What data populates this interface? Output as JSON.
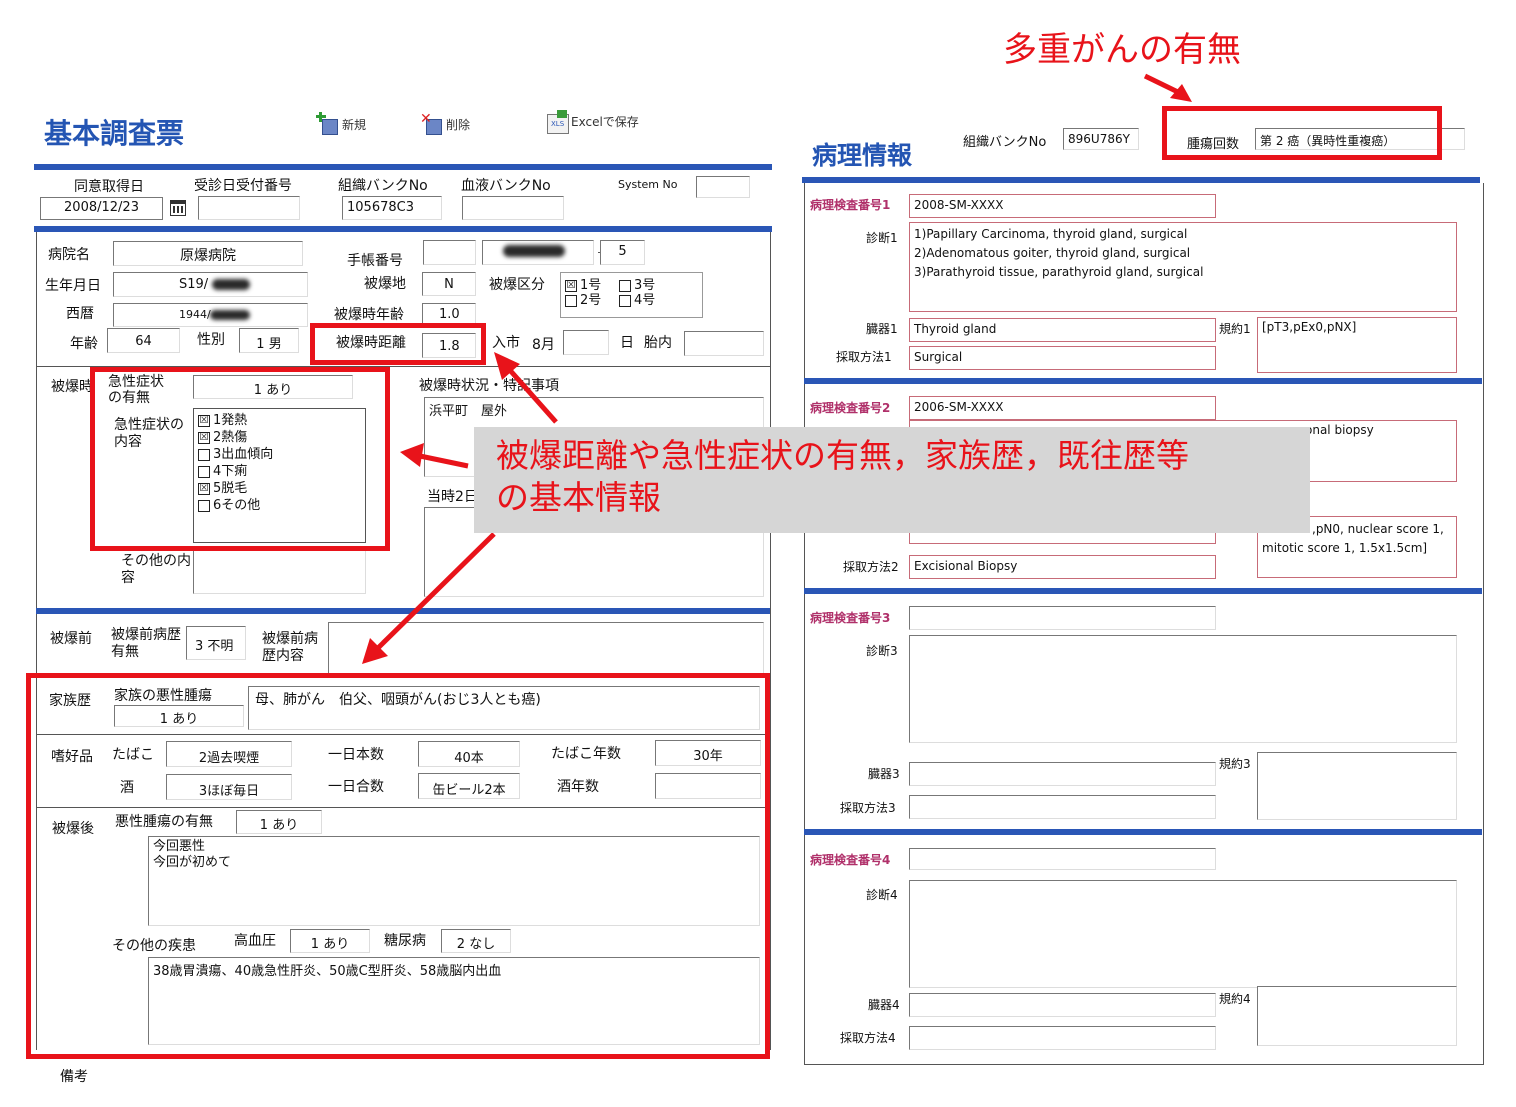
{
  "annotation_top": "多重がんの有無",
  "callout": {
    "line1": "被爆距離や急性症状の有無，家族歴，既往歴等",
    "line2": "の基本情報"
  },
  "left": {
    "title": "基本調査票",
    "toolbar": {
      "new": "新規",
      "delete": "削除",
      "excel": "Excelで保存"
    },
    "row1": {
      "consent_date_label": "同意取得日",
      "consent_date": "2008/12/23",
      "reception_label": "受診日受付番号",
      "tissue_bank_label": "組織バンクNo",
      "tissue_bank": "105678C3",
      "blood_bank_label": "血液バンクNo",
      "system_no_label": "System No"
    },
    "basic": {
      "hospital_label": "病院名",
      "hospital": "原爆病院",
      "notebook_label": "手帳番号",
      "notebook_suffix": "5",
      "birth_label": "生年月日",
      "birth": "S19/",
      "exposure_place_label": "被爆地",
      "exposure_place": "N",
      "exposure_class_label": "被爆区分",
      "class_options": [
        {
          "label": "1号",
          "checked": "☒"
        },
        {
          "label": "3号",
          "checked": ""
        },
        {
          "label": "2号",
          "checked": ""
        },
        {
          "label": "4号",
          "checked": ""
        }
      ],
      "western_label": "西暦",
      "western": "1944/",
      "age_at_exposure_label": "被爆時年齢",
      "age_at_exposure": "1.0",
      "age_label": "年齢",
      "age": "64",
      "sex_label": "性別",
      "sex": "1 男",
      "distance_label": "被爆時距離",
      "distance": "1.8",
      "entry_label": "入市",
      "entry_month": "8月",
      "day_label": "日",
      "in_utero_label": "胎内"
    },
    "acute": {
      "section_label": "被爆時",
      "presence_label": "急性症状の有無",
      "presence": "1 あり",
      "content_label": "急性症状の内容",
      "symptoms": [
        {
          "label": "1発熱",
          "checked": "☒"
        },
        {
          "label": "2熱傷",
          "checked": "☒"
        },
        {
          "label": "3出血傾向",
          "checked": ""
        },
        {
          "label": "4下痢",
          "checked": ""
        },
        {
          "label": "5脱毛",
          "checked": "☒"
        },
        {
          "label": "6その他",
          "checked": ""
        }
      ],
      "other_label": "その他の内容",
      "situation_label": "被爆時状況・特記事項",
      "situation": "浜平町　屋外",
      "situation2_label": "当時2日"
    },
    "pre": {
      "section_label": "被爆前",
      "history_label": "被爆前病歴有無",
      "history": "3 不明",
      "content_label": "被爆前病歴内容"
    },
    "family": {
      "section_label": "家族歴",
      "malignancy_label": "家族の悪性腫瘍",
      "malignancy": "1 あり",
      "detail": "母、肺がん　伯父、咽頭がん(おじ3人とも癌)"
    },
    "habits": {
      "section_label": "嗜好品",
      "tobacco_label": "たばこ",
      "tobacco": "2過去喫煙",
      "daily_count_label": "一日本数",
      "daily_count": "40本",
      "tobacco_years_label": "たばこ年数",
      "tobacco_years": "30年",
      "alcohol_label": "酒",
      "alcohol": "3ほぼ毎日",
      "daily_amount_label": "一日合数",
      "daily_amount": "缶ビール2本",
      "alcohol_years_label": "酒年数"
    },
    "post": {
      "section_label": "被爆後",
      "malignancy_label": "悪性腫瘍の有無",
      "malignancy": "1 あり",
      "note_line1": "今回悪性",
      "note_line2": "今回が初めて",
      "other_disease_label": "その他の疾患",
      "hypertension_label": "高血圧",
      "hypertension": "1 あり",
      "diabetes_label": "糖尿病",
      "diabetes": "2 なし",
      "other_detail": "38歳胃潰瘍、40歳急性肝炎、50歳C型肝炎、58歳脳内出血"
    },
    "remarks_label": "備考"
  },
  "right": {
    "title": "病理情報",
    "tissue_bank_label": "組織バンクNo",
    "tissue_bank": "896U786Y",
    "tumor_count_label": "腫瘍回数",
    "tumor_count": "第 2 癌（異時性重複癌）",
    "path1": {
      "no_label": "病理検査番号1",
      "no": "2008-SM-XXXX",
      "dx_label": "診断1",
      "dx_lines": [
        "1)Papillary Carcinoma, thyroid gland, surgical",
        "2)Adenomatous goiter, thyroid gland, surgical",
        "3)Parathyroid tissue, parathyroid gland, surgical"
      ],
      "organ_label": "臓器1",
      "organ": "Thyroid gland",
      "rule_label": "規約1",
      "rule": "[pT3,pEx0,pNX]",
      "method_label": "採取方法1",
      "method": "Surgical"
    },
    "path2": {
      "no_label": "病理検査番号2",
      "no": "2006-SM-XXXX",
      "dx_fragment": "onal biopsy",
      "rule_line1": ",pN0, nuclear score 1,",
      "rule_line2": "mitotic score 1, 1.5x1.5cm]",
      "method_label": "採取方法2",
      "method": "Excisional Biopsy"
    },
    "path3": {
      "no_label": "病理検査番号3",
      "dx_label": "診断3",
      "organ_label": "臓器3",
      "rule_label": "規約3",
      "method_label": "採取方法3"
    },
    "path4": {
      "no_label": "病理検査番号4",
      "dx_label": "診断4",
      "organ_label": "臓器4",
      "rule_label": "規約4",
      "method_label": "採取方法4"
    }
  }
}
